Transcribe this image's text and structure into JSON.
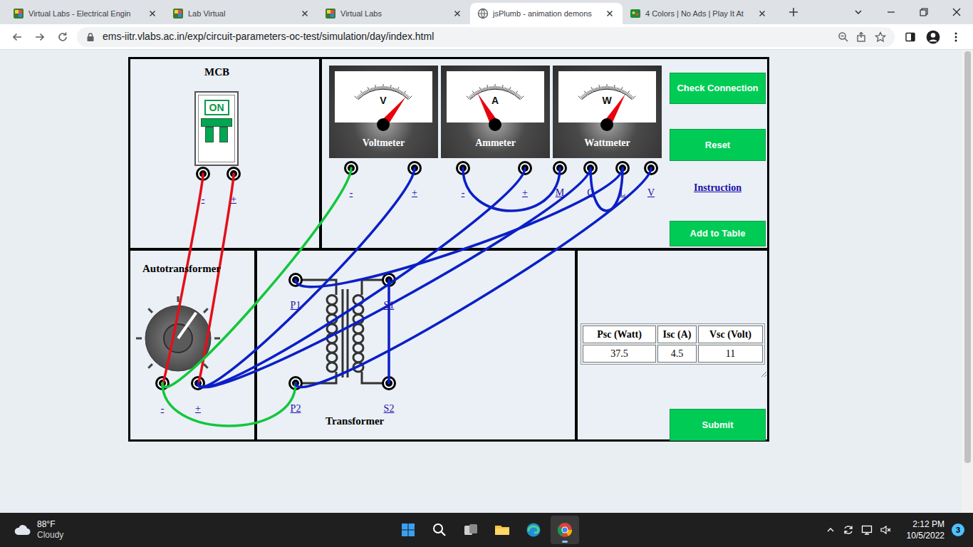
{
  "browser": {
    "tabs": [
      {
        "label": "Virtual Labs - Electrical Engin",
        "selected": false,
        "kind": "vlabs"
      },
      {
        "label": "Lab Virtual",
        "selected": false,
        "kind": "vlabs"
      },
      {
        "label": "Virtual Labs",
        "selected": false,
        "kind": "vlabs"
      },
      {
        "label": "jsPlumb - animation demons",
        "selected": true,
        "kind": "globe"
      },
      {
        "label": "4 Colors | No Ads | Play It At",
        "selected": false,
        "kind": "game"
      }
    ],
    "url": "ems-iitr.vlabs.ac.in/exp/circuit-parameters-oc-test/simulation/day/index.html"
  },
  "mcb": {
    "title": "MCB",
    "switch_label": "ON",
    "on": true,
    "terminals": [
      "-",
      "+"
    ]
  },
  "meters": [
    {
      "name": "Voltmeter",
      "symbol": "V",
      "level": 0.89,
      "terminals": [
        "-",
        "+"
      ]
    },
    {
      "name": "Ammeter",
      "symbol": "A",
      "level": 0.21,
      "terminals": [
        "-",
        "+"
      ]
    },
    {
      "name": "Wattmeter",
      "symbol": "W",
      "level": 0.81,
      "terminals": [
        "M",
        "C",
        "L",
        "V"
      ]
    }
  ],
  "controls": {
    "check_connection": "Check Connection",
    "reset": "Reset",
    "instruction": "Instruction",
    "add_to_table": "Add to Table",
    "submit": "Submit"
  },
  "autotransformer": {
    "title": "Autotransformer",
    "level": 0.63,
    "terminals": [
      "-",
      "+"
    ]
  },
  "transformer": {
    "title": "Transformer",
    "terminals": [
      "P1",
      "S1",
      "P2",
      "S2"
    ]
  },
  "table": {
    "columns": [
      "Psc (Watt)",
      "Isc (A)",
      "Vsc (Volt)"
    ],
    "rows": [
      [
        "37.5",
        "4.5",
        "11"
      ]
    ]
  },
  "wires": [
    {
      "color": "#e30f1b"
    },
    {
      "color": "#e30f1b"
    },
    {
      "color": "#14c63c"
    },
    {
      "color": "#14c63c"
    },
    {
      "color": "#0b1fc7"
    },
    {
      "color": "#0b1fc7"
    },
    {
      "color": "#0b1fc7"
    },
    {
      "color": "#0b1fc7"
    },
    {
      "color": "#0b1fc7"
    },
    {
      "color": "#0b1fc7"
    },
    {
      "color": "#0b1fc7"
    },
    {
      "color": "#0b1fc7"
    }
  ],
  "taskbar": {
    "weather": {
      "temperature": "88°F",
      "condition": "Cloudy"
    },
    "apps": [
      {
        "kind": "start",
        "selected": false
      },
      {
        "kind": "search",
        "selected": false
      },
      {
        "kind": "taskview",
        "selected": false
      },
      {
        "kind": "explorer",
        "selected": false
      },
      {
        "kind": "edge",
        "selected": false
      },
      {
        "kind": "chrome",
        "selected": true
      }
    ],
    "time": "2:12 PM",
    "date": "10/5/2022",
    "notifications": "3"
  }
}
